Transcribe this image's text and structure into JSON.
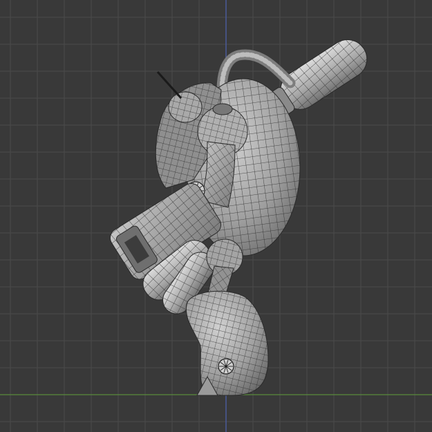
{
  "viewport": {
    "view": "right-orthographic",
    "shading": "wireframe-over-solid",
    "object": "robot-mesh"
  },
  "colors": {
    "background": "#393939",
    "grid_line": "#4a4a4a",
    "grid_major": "#505050",
    "x_axis": "#5a8a3c",
    "z_axis": "#4c5fa8",
    "mesh_fill": "#9c9c9c",
    "mesh_shade": "#6e6e6e",
    "wire": "#2a2a2a",
    "highlight": "#d8d8d8"
  }
}
